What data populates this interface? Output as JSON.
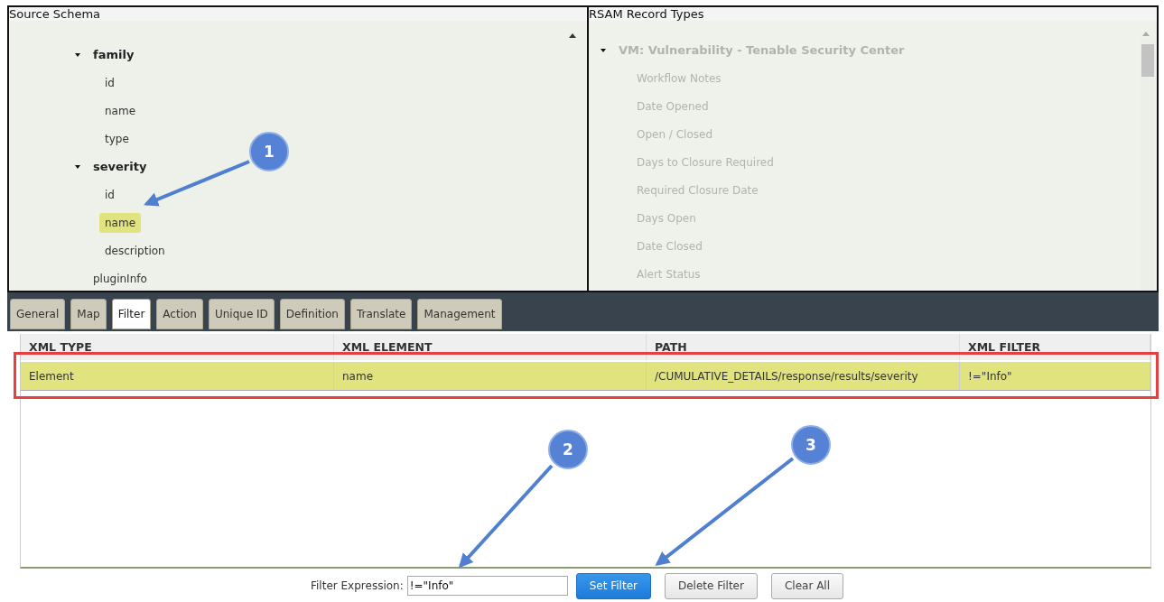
{
  "source_schema": {
    "title": "Source Schema",
    "tree": [
      {
        "label": "family",
        "expanded": true,
        "selected": false,
        "children": [
          {
            "label": "id",
            "selected": false
          },
          {
            "label": "name",
            "selected": false
          },
          {
            "label": "type",
            "selected": false
          }
        ]
      },
      {
        "label": "severity",
        "expanded": true,
        "selected": false,
        "children": [
          {
            "label": "id",
            "selected": false
          },
          {
            "label": "name",
            "selected": true
          },
          {
            "label": "description",
            "selected": false
          }
        ]
      },
      {
        "label": "pluginInfo",
        "selected": false
      }
    ]
  },
  "record_types": {
    "title": "RSAM  Record Types",
    "tree": [
      {
        "label": "VM: Vulnerability - Tenable Security Center",
        "expanded": true,
        "disabled": true,
        "children": [
          {
            "label": "Workflow Notes",
            "disabled": true
          },
          {
            "label": "Date Opened",
            "disabled": true
          },
          {
            "label": "Open / Closed",
            "disabled": true
          },
          {
            "label": "Days to Closure Required",
            "disabled": true
          },
          {
            "label": "Required Closure Date",
            "disabled": true
          },
          {
            "label": "Days Open",
            "disabled": true
          },
          {
            "label": "Date Closed",
            "disabled": true
          },
          {
            "label": "Alert Status",
            "disabled": true
          }
        ]
      }
    ]
  },
  "tabs": [
    {
      "label": "General",
      "selected": false
    },
    {
      "label": "Map",
      "selected": false
    },
    {
      "label": "Filter",
      "selected": true
    },
    {
      "label": "Action",
      "selected": false
    },
    {
      "label": "Unique ID",
      "selected": false
    },
    {
      "label": "Definition",
      "selected": false
    },
    {
      "label": "Translate",
      "selected": false
    },
    {
      "label": "Management",
      "selected": false
    }
  ],
  "table": {
    "columns": [
      "XML TYPE",
      "XML ELEMENT",
      "PATH",
      "XML FILTER"
    ],
    "rows": [
      {
        "selected": true,
        "highlighted": true,
        "cells": [
          "Element",
          "name",
          "/CUMULATIVE_DETAILS/response/results/severity",
          " !=\"Info\""
        ]
      }
    ]
  },
  "filter_bar": {
    "label": "Filter Expression:",
    "value": "!=\"Info\"",
    "buttons": [
      {
        "label": "Set Filter",
        "primary": true
      },
      {
        "label": "Delete Filter",
        "primary": false
      },
      {
        "label": "Clear All",
        "primary": false
      }
    ]
  },
  "callouts": [
    {
      "number": "1"
    },
    {
      "number": "2"
    },
    {
      "number": "3"
    }
  ]
}
